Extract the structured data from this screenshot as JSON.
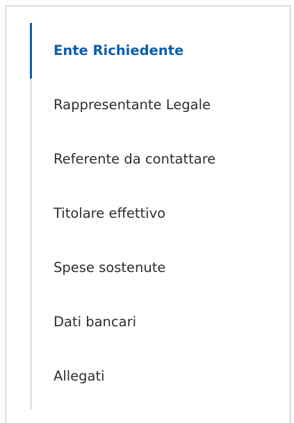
{
  "nav": {
    "active_index": 0,
    "colors": {
      "accent": "#0b5ea8",
      "text": "#2b2f33",
      "rail": "#dfe3e7",
      "border": "#b9c1c8"
    },
    "items": [
      {
        "label": "Ente Richiedente"
      },
      {
        "label": "Rappresentante Legale"
      },
      {
        "label": "Referente da contattare"
      },
      {
        "label": "Titolare effettivo"
      },
      {
        "label": "Spese sostenute"
      },
      {
        "label": "Dati bancari"
      },
      {
        "label": "Allegati"
      }
    ]
  }
}
